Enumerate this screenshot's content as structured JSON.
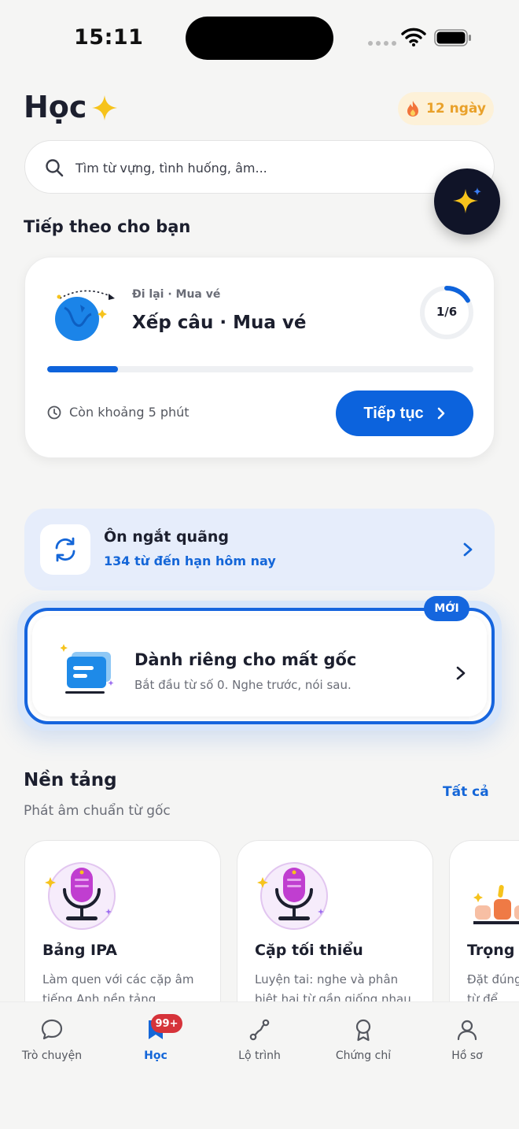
{
  "status_bar": {
    "time": "15:11"
  },
  "header": {
    "title": "Học",
    "streak": "12 ngày"
  },
  "search": {
    "placeholder": "Tìm từ vựng, tình huống, âm..."
  },
  "next_section": {
    "heading": "Tiếp theo cho bạn",
    "category": "Đi lại · Mua vé",
    "title": "Xếp câu · Mua vé",
    "progress_label": "1/6",
    "progress_fraction": 0.1667,
    "time_left": "Còn khoảng 5 phút",
    "continue_label": "Tiếp tục"
  },
  "review": {
    "title": "Ôn ngắt quãng",
    "subtitle": "134 từ đến hạn hôm nay"
  },
  "beginner": {
    "badge": "MỚI",
    "title": "Dành riêng cho mất gốc",
    "subtitle": "Bắt đầu từ số 0. Nghe trước, nói sau."
  },
  "foundation": {
    "heading": "Nền tảng",
    "subtitle": "Phát âm chuẩn từ gốc",
    "see_all": "Tất cả",
    "cards": [
      {
        "title": "Bảng IPA",
        "desc": "Làm quen với các cặp âm tiếng Anh nền tảng."
      },
      {
        "title": "Cặp tối thiểu",
        "desc": "Luyện tai: nghe và phân biệt hai từ gần giống nhau."
      },
      {
        "title": "Trọng â",
        "desc": "Đặt đúng từ để ngh"
      }
    ]
  },
  "tab_bar": {
    "badge": "99+",
    "items": [
      {
        "label": "Trò chuyện",
        "icon": "chat-icon"
      },
      {
        "label": "Học",
        "icon": "bookmark-icon"
      },
      {
        "label": "Lộ trình",
        "icon": "route-icon"
      },
      {
        "label": "Chứng chỉ",
        "icon": "award-icon"
      },
      {
        "label": "Hồ sơ",
        "icon": "profile-icon"
      }
    ]
  },
  "colors": {
    "accent": "#0c63dd",
    "streak": "#e9a12a",
    "badge": "#d6333a",
    "background": "#f5f5f4"
  }
}
